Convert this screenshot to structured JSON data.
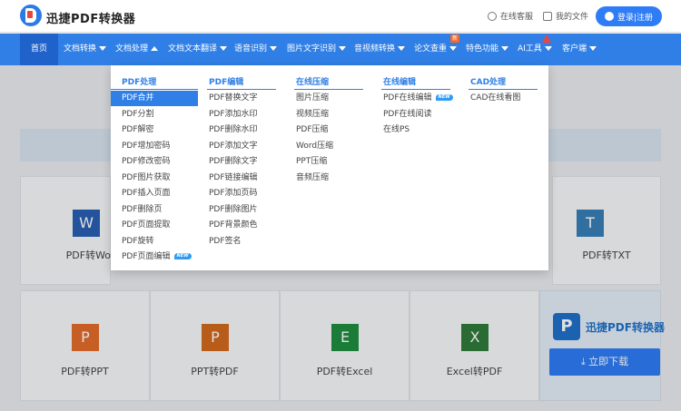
{
  "header": {
    "brand": "迅捷PDF转换器",
    "service": "在线客服",
    "my_files": "我的文件",
    "login": "登录|注册"
  },
  "nav": {
    "items": [
      {
        "label": "首页"
      },
      {
        "label": "文档转换"
      },
      {
        "label": "文档处理"
      },
      {
        "label": "文档文本翻译"
      },
      {
        "label": "语音识别"
      },
      {
        "label": "图片文字识别"
      },
      {
        "label": "音视频转换"
      },
      {
        "label": "论文查重"
      },
      {
        "label": "特色功能"
      },
      {
        "label": "AI工具"
      },
      {
        "label": "客户端"
      }
    ],
    "new_badge": "新"
  },
  "dropdown": {
    "columns": [
      {
        "title": "PDF处理",
        "items": [
          "PDF合并",
          "PDF分割",
          "PDF解密",
          "PDF增加密码",
          "PDF修改密码",
          "PDF图片获取",
          "PDF插入页面",
          "PDF删除页",
          "PDF页面提取",
          "PDF旋转",
          "PDF页面编辑"
        ]
      },
      {
        "title": "PDF编辑",
        "items": [
          "PDF替换文字",
          "PDF添加水印",
          "PDF删除水印",
          "PDF添加文字",
          "PDF删除文字",
          "PDF链接编辑",
          "PDF添加页码",
          "PDF删除图片",
          "PDF背景颜色",
          "PDF签名"
        ]
      },
      {
        "title": "在线压缩",
        "items": [
          "图片压缩",
          "视频压缩",
          "PDF压缩",
          "Word压缩",
          "PPT压缩",
          "音频压缩"
        ]
      },
      {
        "title": "在线编辑",
        "items": [
          "PDF在线编辑",
          "PDF在线阅读",
          "在线PS"
        ]
      },
      {
        "title": "CAD处理",
        "items": [
          "CAD在线看图"
        ]
      }
    ],
    "new_label": "NEW"
  },
  "cards": {
    "row1": [
      {
        "label": "PDF转Word",
        "icon": "W",
        "color": "#2a5fb3"
      },
      {
        "label": "PDF转TXT",
        "icon": "T",
        "color": "#3a7fb8"
      }
    ],
    "row2": [
      {
        "label": "PDF转PPT",
        "icon": "P",
        "color": "#e36b2b"
      },
      {
        "label": "PPT转PDF",
        "icon": "P",
        "color": "#d2691e"
      },
      {
        "label": "PDF转Excel",
        "icon": "E",
        "color": "#1e8e3e"
      },
      {
        "label": "Excel转PDF",
        "icon": "X",
        "color": "#2f7a3a"
      }
    ]
  },
  "promo": {
    "name": "迅捷PDF转换器",
    "logo_letter": "P",
    "download": "立即下载"
  }
}
